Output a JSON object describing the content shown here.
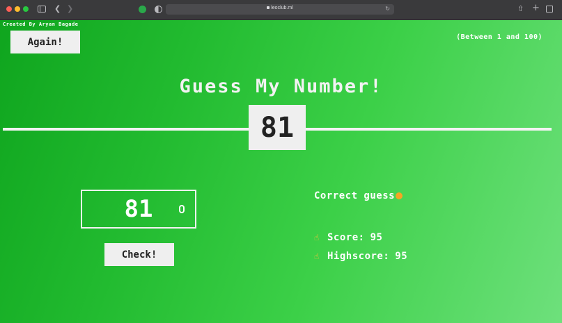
{
  "browser": {
    "url": "leoclub.ml"
  },
  "page": {
    "credit": "Created By Aryan Bagade",
    "again_label": "Again!",
    "range_hint": "(Between 1 and 100)",
    "title": "Guess My Number!",
    "secret_number": "81",
    "guess_value": "81",
    "check_label": "Check!",
    "message": "Correct guess",
    "score_label": "Score:",
    "score_value": "95",
    "highscore_label": "Highscore:",
    "highscore_value": "95"
  },
  "icons": {
    "message_emoji": "star-struck-face-icon",
    "score_icon": "pointing-hand-icon",
    "highscore_icon": "raised-finger-icon"
  },
  "colors": {
    "background_start": "#0fa51e",
    "background_end": "#6ee07c",
    "text": "#ffffff",
    "box": "#efefef"
  }
}
